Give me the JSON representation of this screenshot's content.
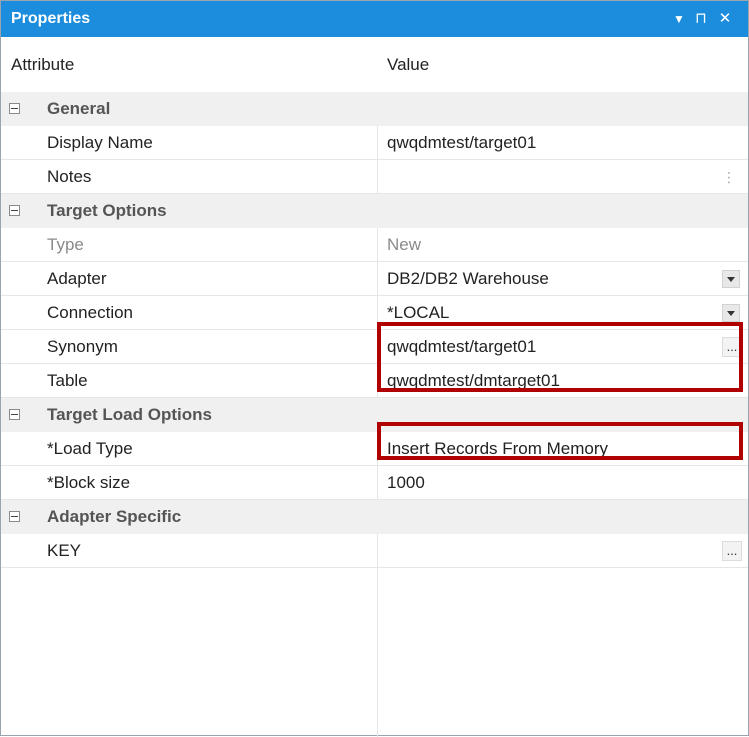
{
  "window": {
    "title": "Properties",
    "menu_icon": "▼",
    "pin_icon": "⊓",
    "close_icon": "✕"
  },
  "header": {
    "attribute": "Attribute",
    "value": "Value"
  },
  "categories": {
    "general": {
      "label": "General",
      "rows": {
        "display_name": {
          "attr": "Display Name",
          "value": "qwqdmtest/target01"
        },
        "notes": {
          "attr": "Notes",
          "value": ""
        }
      }
    },
    "target_options": {
      "label": "Target Options",
      "rows": {
        "type": {
          "attr": "Type",
          "value": "New"
        },
        "adapter": {
          "attr": "Adapter",
          "value": "DB2/DB2 Warehouse"
        },
        "connection": {
          "attr": "Connection",
          "value": "*LOCAL"
        },
        "synonym": {
          "attr": "Synonym",
          "value": "qwqdmtest/target01"
        },
        "table": {
          "attr": "Table",
          "value": "qwqdmtest/dmtarget01"
        }
      }
    },
    "target_load_options": {
      "label": "Target Load Options",
      "rows": {
        "load_type": {
          "attr": "*Load Type",
          "value": "Insert Records From Memory"
        },
        "block_size": {
          "attr": "*Block size",
          "value": "1000"
        }
      }
    },
    "adapter_specific": {
      "label": "Adapter Specific",
      "rows": {
        "key": {
          "attr": "KEY",
          "value": ""
        }
      }
    }
  },
  "buttons": {
    "ellipsis": "...",
    "more": "⋮"
  },
  "colors": {
    "titlebar": "#1c8ddc",
    "highlight": "#b00000",
    "category_bg": "#f0f0f0"
  }
}
